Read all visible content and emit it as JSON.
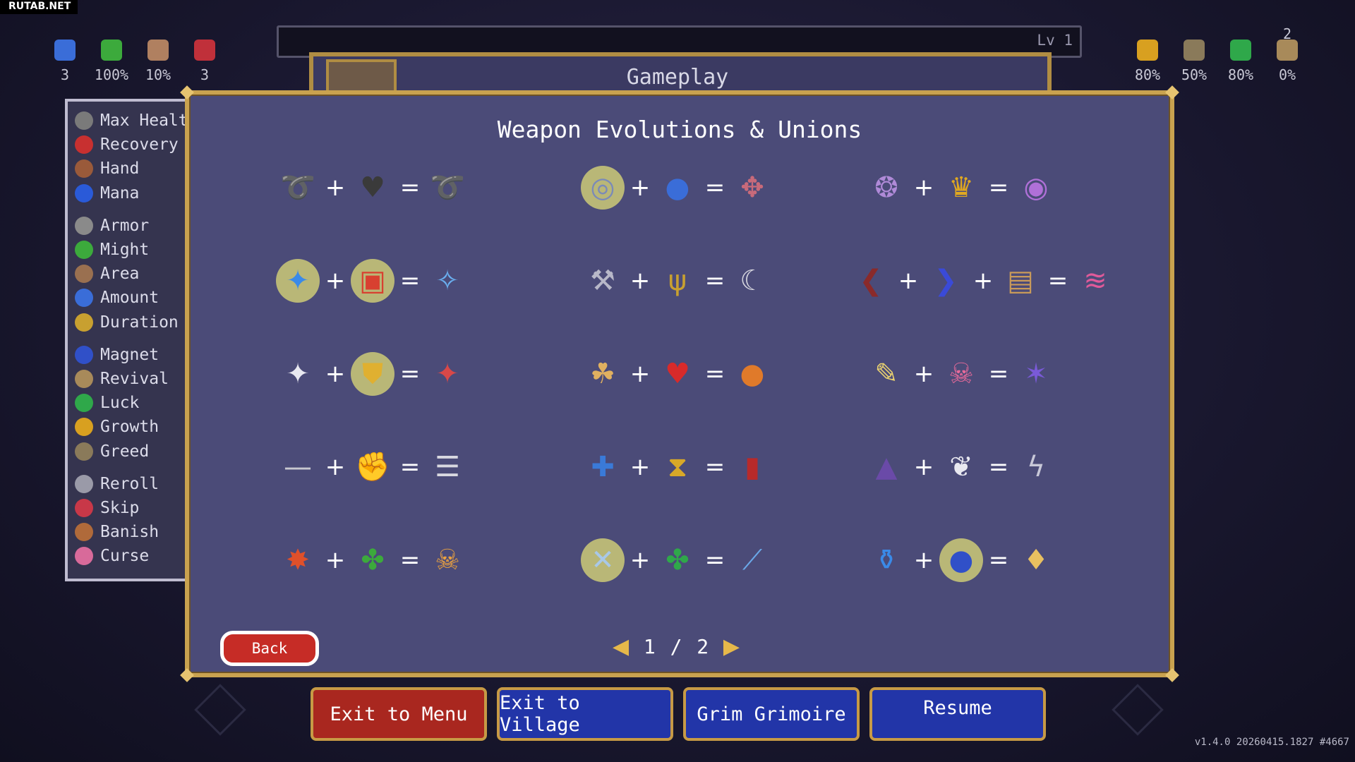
{
  "watermark": "RUTAB.NET",
  "top_left_stats": [
    {
      "icon": "amount-icon",
      "value": "3",
      "color": "#3a6dd8"
    },
    {
      "icon": "leaf-icon",
      "value": "100%",
      "color": "#3caa3c"
    },
    {
      "icon": "candles-icon",
      "value": "10%",
      "color": "#b08060"
    },
    {
      "icon": "heart-icon",
      "value": "3",
      "color": "#c0303a"
    }
  ],
  "top_right_stats": [
    {
      "icon": "crown-icon",
      "value": "80%",
      "color": "#d8a020"
    },
    {
      "icon": "skull-icon",
      "value": "50%",
      "color": "#8a7a5a"
    },
    {
      "icon": "clover-icon",
      "value": "80%",
      "color": "#2fa84a"
    },
    {
      "icon": "book-stack-icon",
      "value": "0%",
      "badge": "2",
      "color": "#a88a5a"
    }
  ],
  "level_label": "Lv 1",
  "gameplay_title": "Gameplay",
  "stats": [
    {
      "label": "Max Healt",
      "icon": "heart-icon",
      "color": "#7a7a7a"
    },
    {
      "label": "Recovery",
      "icon": "heart-recovery-icon",
      "color": "#c83030"
    },
    {
      "label": "Hand",
      "icon": "hand-icon",
      "color": "#9a5a3a"
    },
    {
      "label": "Mana",
      "icon": "mana-icon",
      "color": "#2a5ad8"
    },
    {
      "label": "Armor",
      "icon": "armor-icon",
      "color": "#8a8a8a"
    },
    {
      "label": "Might",
      "icon": "leaf-icon",
      "color": "#3caa3c"
    },
    {
      "label": "Area",
      "icon": "candles-icon",
      "color": "#9a7050"
    },
    {
      "label": "Amount",
      "icon": "amount-icon",
      "color": "#3a6dd8"
    },
    {
      "label": "Duration",
      "icon": "hourglass-icon",
      "color": "#c8a030"
    },
    {
      "label": "Magnet",
      "icon": "magnet-icon",
      "color": "#3050c8"
    },
    {
      "label": "Revival",
      "icon": "book-stack-icon",
      "color": "#a88a5a"
    },
    {
      "label": "Luck",
      "icon": "clover-icon",
      "color": "#2fa84a"
    },
    {
      "label": "Growth",
      "icon": "crown-icon",
      "color": "#d8a020"
    },
    {
      "label": "Greed",
      "icon": "skull-icon",
      "color": "#8a7a5a"
    },
    {
      "label": "Reroll",
      "icon": "dice-icon",
      "color": "#9a9aa8"
    },
    {
      "label": "Skip",
      "icon": "skip-icon",
      "color": "#c83848"
    },
    {
      "label": "Banish",
      "icon": "banish-icon",
      "color": "#b06a3a"
    },
    {
      "label": "Curse",
      "icon": "curse-icon",
      "color": "#d86a9a"
    }
  ],
  "title": "Weapon Evolutions & Unions",
  "recipes": [
    {
      "items": [
        {
          "icon": "whip-icon",
          "glyph": "➰",
          "color": "#d86a2a"
        },
        {
          "icon": "heart-icon",
          "glyph": "♥",
          "color": "#3a3a3a"
        },
        {
          "icon": "bloody-whip-icon",
          "glyph": "➰",
          "color": "#c8282a"
        }
      ]
    },
    {
      "items": [
        {
          "icon": "orbit-ring-icon",
          "glyph": "◎",
          "color": "#7a8ab8",
          "highlight": true
        },
        {
          "icon": "amount-icon",
          "glyph": "●",
          "color": "#3a6dd8"
        },
        {
          "icon": "orbit-cross-icon",
          "glyph": "✥",
          "color": "#c86a7a"
        }
      ]
    },
    {
      "items": [
        {
          "icon": "purple-orb-icon",
          "glyph": "❂",
          "color": "#b08ad8"
        },
        {
          "icon": "crown-icon",
          "glyph": "♛",
          "color": "#e0a820"
        },
        {
          "icon": "spiral-icon",
          "glyph": "◉",
          "color": "#b070d8"
        }
      ]
    },
    {
      "items": [
        {
          "icon": "magic-wand-icon",
          "glyph": "✦",
          "color": "#3a8ae8",
          "highlight": true
        },
        {
          "icon": "tome-icon",
          "glyph": "▣",
          "color": "#d84030",
          "highlight": true
        },
        {
          "icon": "holy-wand-icon",
          "glyph": "✧",
          "color": "#6ab0f0"
        }
      ]
    },
    {
      "items": [
        {
          "icon": "axe-icon",
          "glyph": "⚒",
          "color": "#b8b8c8"
        },
        {
          "icon": "candles-icon",
          "glyph": "ψ",
          "color": "#c8a030"
        },
        {
          "icon": "death-spiral-icon",
          "glyph": "☾",
          "color": "#d8d8e0"
        }
      ]
    },
    {
      "items": [
        {
          "icon": "black-wing-icon",
          "glyph": "❮",
          "color": "#8a2a2a"
        },
        {
          "icon": "blue-wing-icon",
          "glyph": "❯",
          "color": "#3a4ad8"
        },
        {
          "icon": "book-stack-icon",
          "glyph": "▤",
          "color": "#c89a5a"
        },
        {
          "icon": "pink-wing-icon",
          "glyph": "≋",
          "color": "#e05a9a"
        }
      ]
    },
    {
      "items": [
        {
          "icon": "cross-icon",
          "glyph": "✦",
          "color": "#e8e8f0"
        },
        {
          "icon": "armor-icon",
          "glyph": "⛊",
          "color": "#e0b030",
          "highlight": true
        },
        {
          "icon": "heaven-sword-icon",
          "glyph": "✦",
          "color": "#d84848"
        }
      ]
    },
    {
      "items": [
        {
          "icon": "garlic-icon",
          "glyph": "☘",
          "color": "#e0b060"
        },
        {
          "icon": "heart-recovery-icon",
          "glyph": "♥",
          "color": "#d82a2a"
        },
        {
          "icon": "soul-eater-icon",
          "glyph": "●",
          "color": "#e07a2a"
        }
      ]
    },
    {
      "items": [
        {
          "icon": "scroll-icon",
          "glyph": "✎",
          "color": "#e8d070"
        },
        {
          "icon": "curse-icon",
          "glyph": "☠",
          "color": "#e86a9a"
        },
        {
          "icon": "star-tome-icon",
          "glyph": "✶",
          "color": "#7a5ad8"
        }
      ]
    },
    {
      "items": [
        {
          "icon": "knife-icon",
          "glyph": "—",
          "color": "#c8c8d0"
        },
        {
          "icon": "hand-icon",
          "glyph": "✊",
          "color": "#a05a3a"
        },
        {
          "icon": "thousand-edge-icon",
          "glyph": "☰",
          "color": "#d8d8e0"
        }
      ]
    },
    {
      "items": [
        {
          "icon": "king-bible-icon",
          "glyph": "✚",
          "color": "#3a7ad8"
        },
        {
          "icon": "hourglass-icon",
          "glyph": "⧗",
          "color": "#d8a828"
        },
        {
          "icon": "unholy-vespers-icon",
          "glyph": "▮",
          "color": "#b82a2a"
        }
      ]
    },
    {
      "items": [
        {
          "icon": "wand-tip-icon",
          "glyph": "▲",
          "color": "#6a4aa8"
        },
        {
          "icon": "wing-icon",
          "glyph": "❦",
          "color": "#e8e8f0"
        },
        {
          "icon": "lightning-ring-icon",
          "glyph": "ϟ",
          "color": "#c8c8d8"
        }
      ]
    },
    {
      "items": [
        {
          "icon": "fire-wand-icon",
          "glyph": "✸",
          "color": "#e0502a"
        },
        {
          "icon": "spinach-icon",
          "glyph": "✤",
          "color": "#3caa3c"
        },
        {
          "icon": "hellfire-icon",
          "glyph": "☠",
          "color": "#e8a040"
        }
      ]
    },
    {
      "items": [
        {
          "icon": "santa-water-icon",
          "glyph": "✕",
          "color": "#a8c8e8",
          "highlight": true
        },
        {
          "icon": "clover-icon",
          "glyph": "✤",
          "color": "#2fa84a"
        },
        {
          "icon": "la-borra-icon",
          "glyph": "⟋",
          "color": "#6aa8e8"
        }
      ]
    },
    {
      "items": [
        {
          "icon": "potion-icon",
          "glyph": "⚱",
          "color": "#3a8ae8"
        },
        {
          "icon": "magnet-icon",
          "glyph": "●",
          "color": "#3050c8",
          "highlight": true
        },
        {
          "icon": "flask-icon",
          "glyph": "♦",
          "color": "#e8c060"
        }
      ]
    }
  ],
  "back_label": "Back",
  "pager": {
    "current": "1",
    "separator": "/",
    "total": "2"
  },
  "bottom_buttons": [
    {
      "label": "Exit to Menu"
    },
    {
      "label": "Exit to Village"
    },
    {
      "label": "Grim Grimoire"
    },
    {
      "label": "Resume"
    }
  ],
  "version": "v1.4.0 20260415.1827 #4667"
}
